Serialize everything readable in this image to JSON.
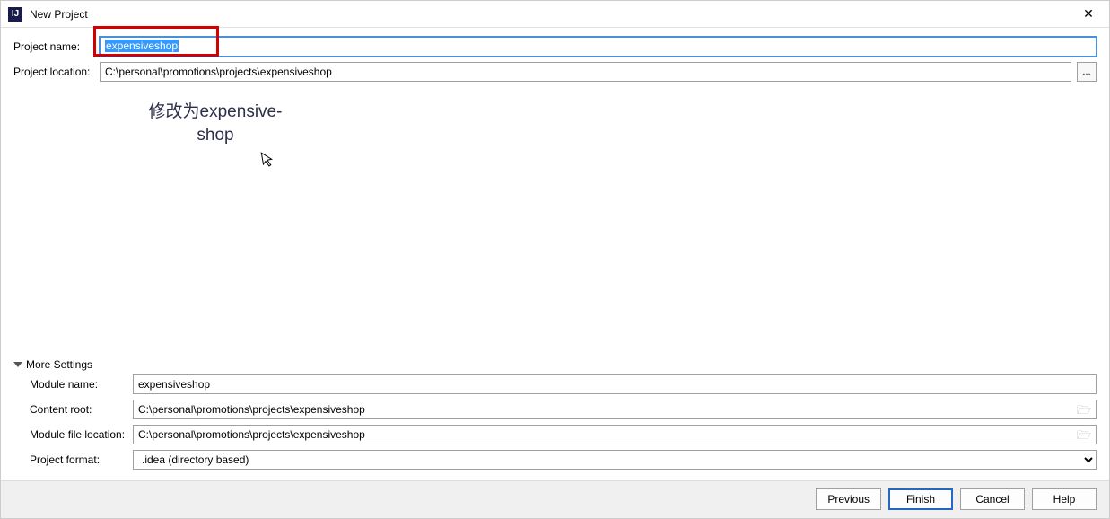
{
  "window": {
    "title": "New Project"
  },
  "labels": {
    "projectName": "Project name:",
    "projectLocation": "Project location:",
    "moreSettings": "More Settings",
    "moduleName": "Module name:",
    "contentRoot": "Content root:",
    "moduleFileLocation": "Module file location:",
    "projectFormat": "Project format:"
  },
  "values": {
    "projectName": "expensiveshop",
    "projectLocation": "C:\\personal\\promotions\\projects\\expensiveshop",
    "moduleName": "expensiveshop",
    "contentRoot": "C:\\personal\\promotions\\projects\\expensiveshop",
    "moduleFileLocation": "C:\\personal\\promotions\\projects\\expensiveshop",
    "projectFormat": ".idea (directory based)"
  },
  "annotation": {
    "textLine1": "修改为expensive-",
    "textLine2": "shop"
  },
  "browseBtn": "...",
  "buttons": {
    "previous": "Previous",
    "finish": "Finish",
    "cancel": "Cancel",
    "help": "Help"
  }
}
